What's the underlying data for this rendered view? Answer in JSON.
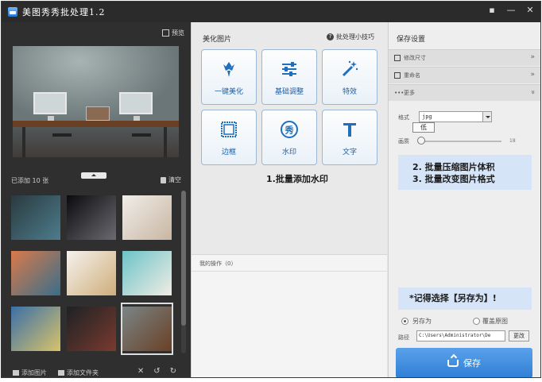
{
  "titlebar": {
    "title": "美图秀秀批处理1.2",
    "controls": [
      "▪",
      "—",
      "✕"
    ]
  },
  "left": {
    "preview_label": "预览",
    "added_count": "已添加 10 张",
    "clear_label": "清空",
    "thumbnails": [
      {
        "name": "phone-on-table",
        "colors": [
          "#2a3a3f",
          "#4d7c8c"
        ]
      },
      {
        "name": "earth-from-space",
        "colors": [
          "#0b0b0f",
          "#6a6a70"
        ]
      },
      {
        "name": "white-cat-portrait",
        "colors": [
          "#f0ede8",
          "#c9b6a2"
        ]
      },
      {
        "name": "coastal-town",
        "colors": [
          "#d97a4a",
          "#3a6e8a"
        ]
      },
      {
        "name": "decor-shelf",
        "colors": [
          "#f5f2ee",
          "#cfae7a"
        ]
      },
      {
        "name": "cat-art-poster",
        "colors": [
          "#6cc3c8",
          "#f1ede4"
        ]
      },
      {
        "name": "city-street",
        "colors": [
          "#3b6fa8",
          "#d7c36a"
        ]
      },
      {
        "name": "dark-office",
        "colors": [
          "#1d2224",
          "#7a3a2f"
        ]
      },
      {
        "name": "desk-with-monitors",
        "colors": [
          "#7a8586",
          "#6a4025"
        ]
      }
    ],
    "bottom": {
      "add_image": "添加图片",
      "add_folder": "添加文件夹",
      "remove": "✕",
      "rotate_left": "↺",
      "rotate_right": "↻"
    }
  },
  "middle": {
    "header": "美化图片",
    "tips": "批处理小技巧",
    "tools": [
      {
        "label": "一键美化",
        "icon": "tulip-icon"
      },
      {
        "label": "基础调整",
        "icon": "sliders-icon"
      },
      {
        "label": "特效",
        "icon": "magic-wand-icon"
      },
      {
        "label": "边框",
        "icon": "frame-icon"
      },
      {
        "label": "水印",
        "icon": "watermark-icon"
      },
      {
        "label": "文字",
        "icon": "text-icon"
      }
    ],
    "annotation": "1.批量添加水印",
    "ops_label": "我的操作（0）"
  },
  "right": {
    "title": "保存设置",
    "sections": [
      {
        "label": "修改尺寸",
        "chevron": "»"
      },
      {
        "label": "重命名",
        "chevron": "»"
      },
      {
        "label": "更多",
        "chevron": "»"
      }
    ],
    "format_label": "格式",
    "format_value": "jpg",
    "format_tooltip": "低",
    "quality_label": "画质",
    "quality_value": "18",
    "annotation_lines": [
      "2. 批量压缩图片体积",
      "3. 批量改变图片格式"
    ],
    "annotation_save": "*记得选择【另存为】!",
    "radio_saveas": "另存为",
    "radio_overwrite": "覆盖原图",
    "path_label": "路径",
    "path_value": "C:\\Users\\Administrator\\De",
    "change_label": "更改",
    "save_label": "保存"
  }
}
